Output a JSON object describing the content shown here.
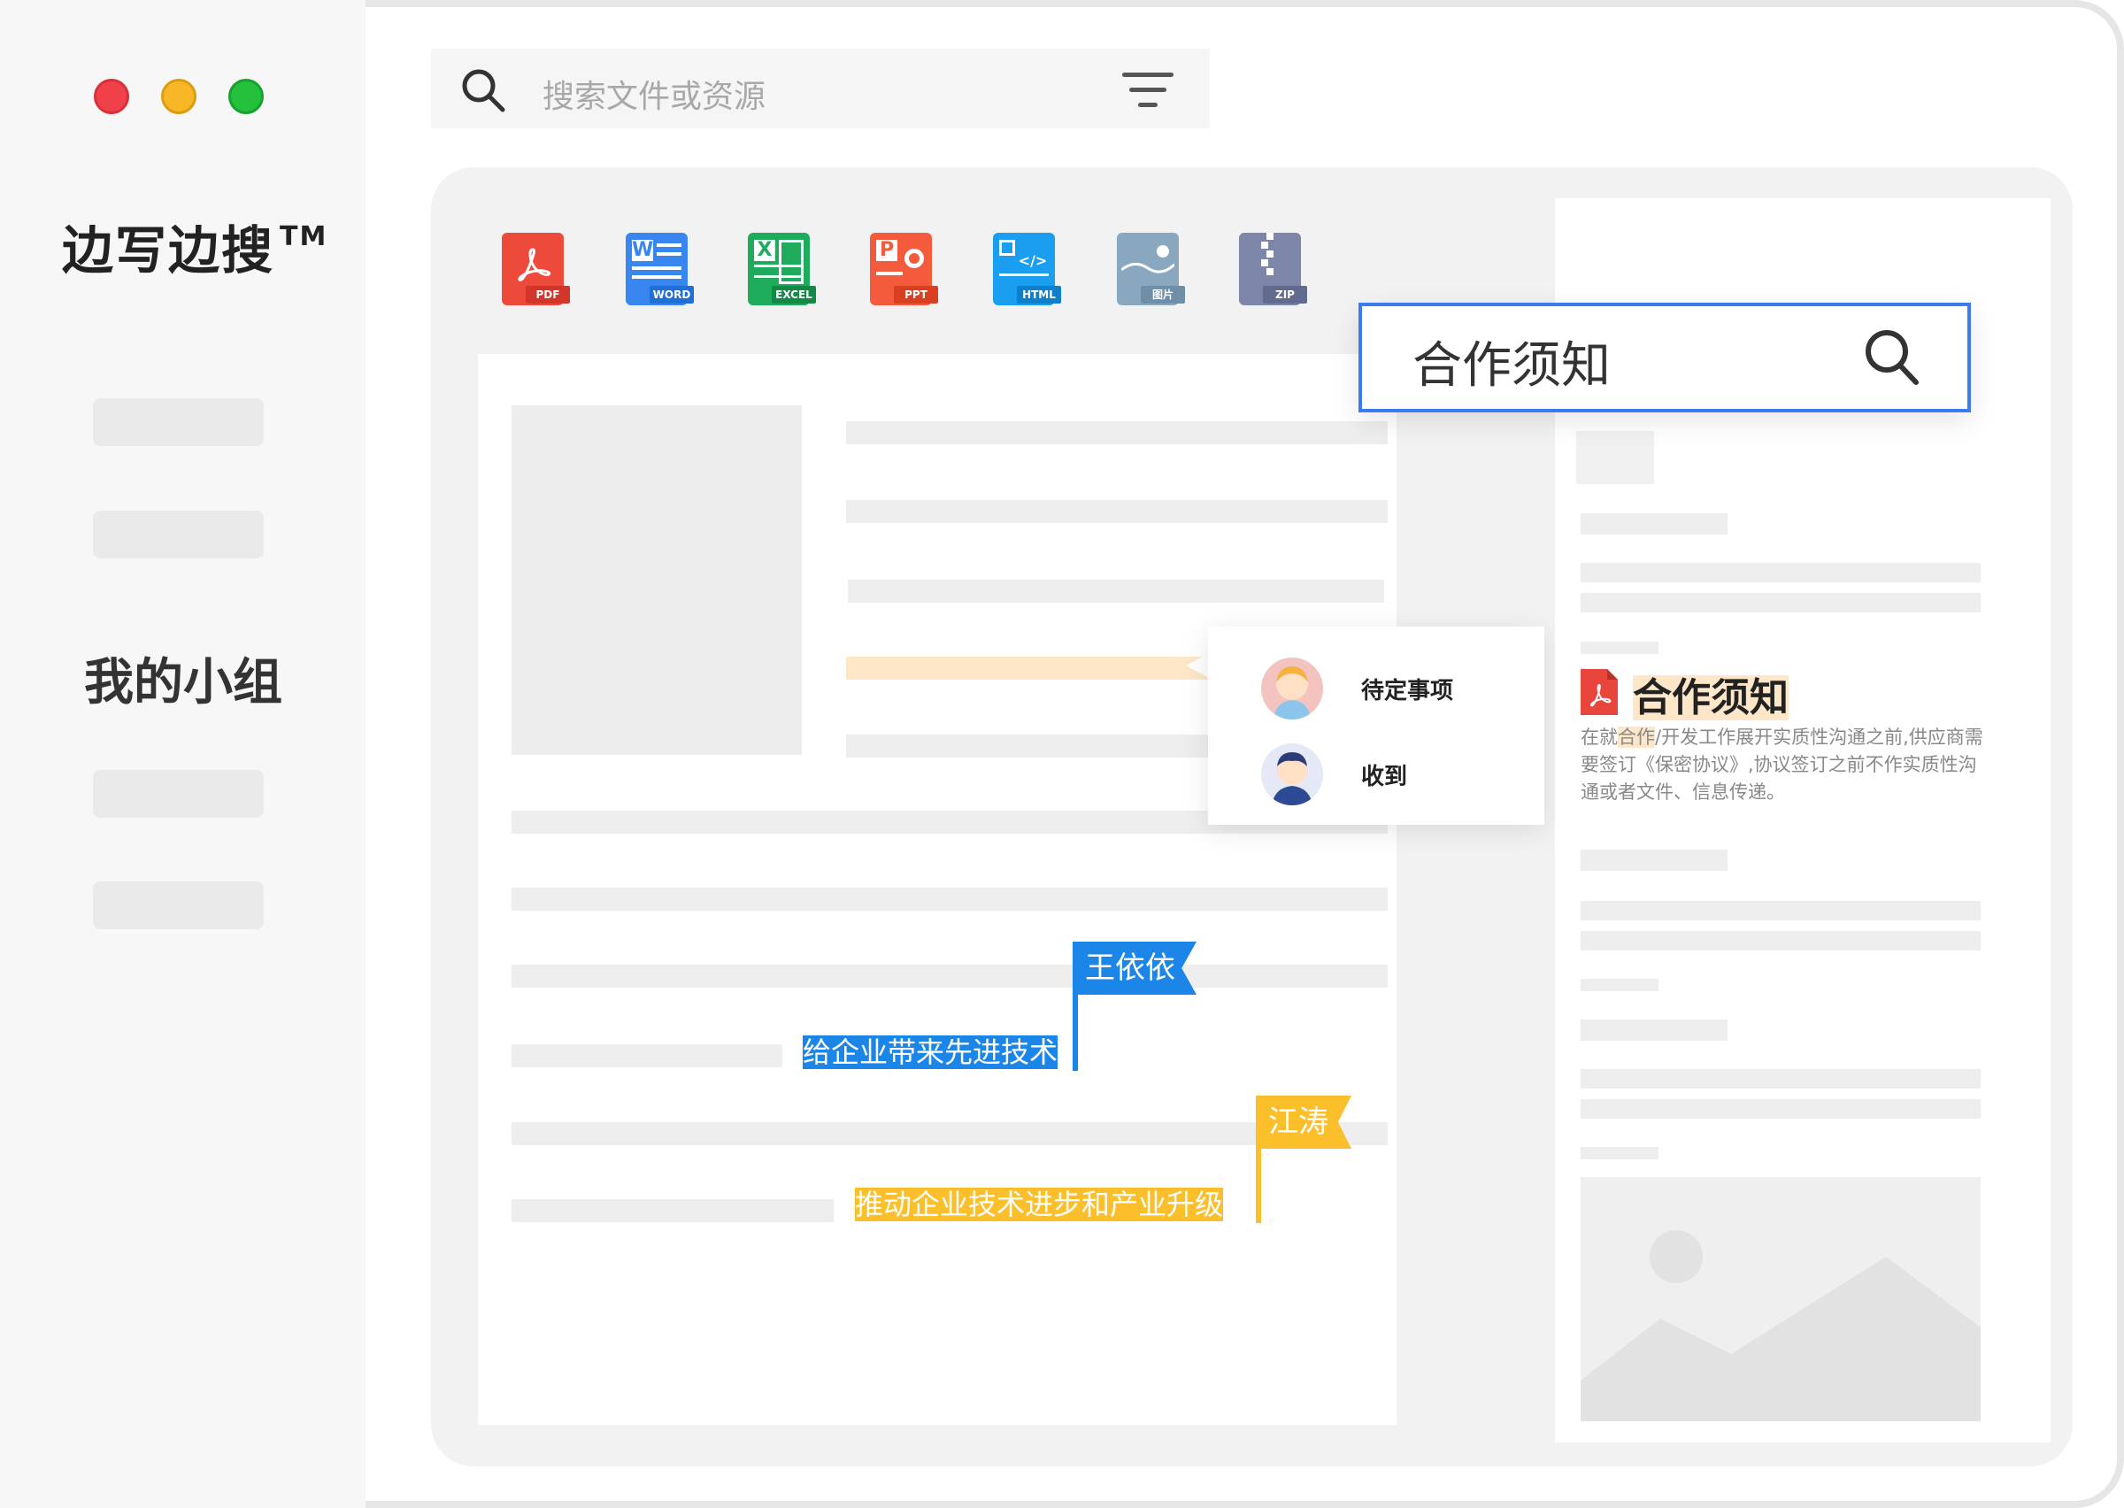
{
  "window": {
    "controls": [
      "close",
      "minimize",
      "maximize"
    ]
  },
  "sidebar": {
    "app_title": "边写边搜",
    "trademark": "TM",
    "group_title": "我的小组"
  },
  "search": {
    "placeholder": "搜索文件或资源",
    "icon": "search-icon",
    "filter_icon": "filter-icon"
  },
  "file_types": [
    {
      "name": "pdf",
      "label": "PDF",
      "color": "#ee4a3c"
    },
    {
      "name": "word",
      "label": "WORD",
      "color": "#3a86f0"
    },
    {
      "name": "excel",
      "label": "EXCEL",
      "color": "#1eab5b"
    },
    {
      "name": "ppt",
      "label": "PPT",
      "color": "#f45a3c"
    },
    {
      "name": "html",
      "label": "HTML",
      "color": "#1a9ff0"
    },
    {
      "name": "image",
      "label": "图片",
      "color": "#8aa7c0"
    },
    {
      "name": "zip",
      "label": "ZIP",
      "color": "#7d85a8"
    }
  ],
  "popup": {
    "items": [
      {
        "label": "待定事项"
      },
      {
        "label": "收到"
      }
    ]
  },
  "annotations": [
    {
      "user": "王依依",
      "selected_text": "给企业带来先进技术",
      "color": "#1b86e8"
    },
    {
      "user": "江涛",
      "selected_text": "推动企业技术进步和产业升级",
      "color": "#fbbf2b"
    }
  ],
  "search_panel": {
    "query": "合作须知",
    "result": {
      "title": "合作须知",
      "snippet_before": "在就",
      "snippet_highlight": "合作",
      "snippet_after": "/开发工作展开实质性沟通之前,供应商需要签订《保密协议》,协议签订之前不作实质性沟通或者文件、信息传递。"
    }
  }
}
